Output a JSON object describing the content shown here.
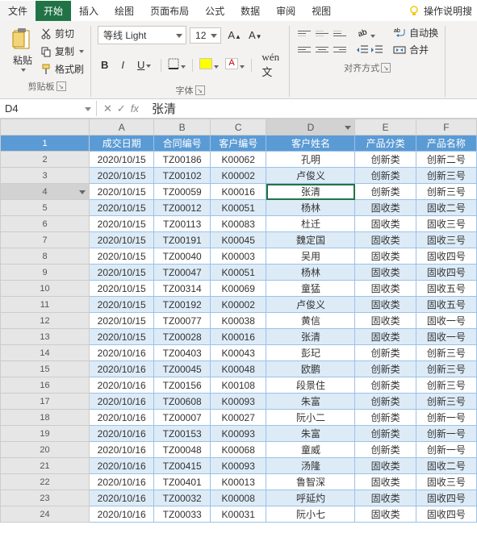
{
  "tabs": {
    "file": "文件",
    "home": "开始",
    "insert": "插入",
    "draw": "绘图",
    "layout": "页面布局",
    "formula": "公式",
    "data": "数据",
    "review": "审阅",
    "view": "视图",
    "tell": "操作说明搜"
  },
  "clipboard": {
    "paste": "粘贴",
    "cut": "剪切",
    "copy": "复制",
    "format_painter": "格式刷",
    "label": "剪贴板"
  },
  "font": {
    "name": "等线 Light",
    "size": "12",
    "label": "字体",
    "bold": "B",
    "italic": "I",
    "underline": "U"
  },
  "align": {
    "wrap": "自动换",
    "merge": "合并",
    "label": "对齐方式"
  },
  "namebox": "D4",
  "formula_bar": "张清",
  "fx": "fx",
  "columns": [
    "A",
    "B",
    "C",
    "D",
    "E",
    "F"
  ],
  "headers": [
    "成交日期",
    "合同编号",
    "客户编号",
    "客户姓名",
    "产品分类",
    "产品名称"
  ],
  "rows": [
    [
      "2020/10/15",
      "TZ00186",
      "K00062",
      "孔明",
      "创新类",
      "创新二号"
    ],
    [
      "2020/10/15",
      "TZ00102",
      "K00002",
      "卢俊义",
      "创新类",
      "创新三号"
    ],
    [
      "2020/10/15",
      "TZ00059",
      "K00016",
      "张清",
      "创新类",
      "创新三号"
    ],
    [
      "2020/10/15",
      "TZ00012",
      "K00051",
      "杨林",
      "固收类",
      "固收二号"
    ],
    [
      "2020/10/15",
      "TZ00113",
      "K00083",
      "杜迁",
      "固收类",
      "固收三号"
    ],
    [
      "2020/10/15",
      "TZ00191",
      "K00045",
      "魏定国",
      "固收类",
      "固收三号"
    ],
    [
      "2020/10/15",
      "TZ00040",
      "K00003",
      "吴用",
      "固收类",
      "固收四号"
    ],
    [
      "2020/10/15",
      "TZ00047",
      "K00051",
      "杨林",
      "固收类",
      "固收四号"
    ],
    [
      "2020/10/15",
      "TZ00314",
      "K00069",
      "童猛",
      "固收类",
      "固收五号"
    ],
    [
      "2020/10/15",
      "TZ00192",
      "K00002",
      "卢俊义",
      "固收类",
      "固收五号"
    ],
    [
      "2020/10/15",
      "TZ00077",
      "K00038",
      "黄信",
      "固收类",
      "固收一号"
    ],
    [
      "2020/10/15",
      "TZ00028",
      "K00016",
      "张清",
      "固收类",
      "固收一号"
    ],
    [
      "2020/10/16",
      "TZ00403",
      "K00043",
      "彭玘",
      "创新类",
      "创新三号"
    ],
    [
      "2020/10/16",
      "TZ00045",
      "K00048",
      "欧鹏",
      "创新类",
      "创新三号"
    ],
    [
      "2020/10/16",
      "TZ00156",
      "K00108",
      "段景住",
      "创新类",
      "创新三号"
    ],
    [
      "2020/10/16",
      "TZ00608",
      "K00093",
      "朱富",
      "创新类",
      "创新三号"
    ],
    [
      "2020/10/16",
      "TZ00007",
      "K00027",
      "阮小二",
      "创新类",
      "创新一号"
    ],
    [
      "2020/10/16",
      "TZ00153",
      "K00093",
      "朱富",
      "创新类",
      "创新一号"
    ],
    [
      "2020/10/16",
      "TZ00048",
      "K00068",
      "童威",
      "创新类",
      "创新一号"
    ],
    [
      "2020/10/16",
      "TZ00415",
      "K00093",
      "汤隆",
      "固收类",
      "固收二号"
    ],
    [
      "2020/10/16",
      "TZ00401",
      "K00013",
      "鲁智深",
      "固收类",
      "固收三号"
    ],
    [
      "2020/10/16",
      "TZ00032",
      "K00008",
      "呼延灼",
      "固收类",
      "固收四号"
    ],
    [
      "2020/10/16",
      "TZ00033",
      "K00031",
      "阮小七",
      "固收类",
      "固收四号"
    ]
  ],
  "active_cell": {
    "row": 2,
    "col": 3
  }
}
